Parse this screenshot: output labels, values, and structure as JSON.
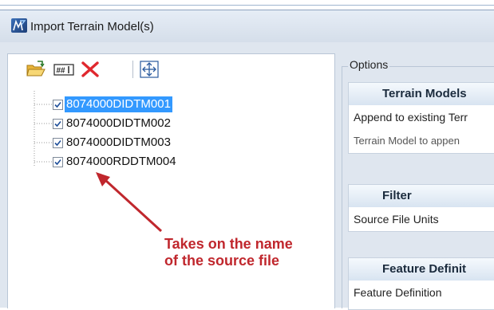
{
  "window": {
    "title": "Import Terrain Model(s)"
  },
  "toolbar": {
    "buttons": [
      {
        "icon": "folder-open-icon"
      },
      {
        "icon": "hash-grid-icon"
      },
      {
        "icon": "delete-x-icon"
      },
      {
        "icon": "move-arrows-icon"
      }
    ]
  },
  "tree": {
    "items": [
      {
        "label": "8074000DIDTM001",
        "checked": true,
        "selected": true
      },
      {
        "label": "8074000DIDTM002",
        "checked": true,
        "selected": false
      },
      {
        "label": "8074000DIDTM003",
        "checked": true,
        "selected": false
      },
      {
        "label": "8074000RDDTM004",
        "checked": true,
        "selected": false
      }
    ]
  },
  "annotation": {
    "line1": "Takes on the name",
    "line2": "of the source file",
    "color": "#c0272d"
  },
  "options": {
    "label": "Options",
    "terrain_models": {
      "header": "Terrain Models",
      "append_label": "Append to existing Terr",
      "append_target_label": "Terrain Model to appen"
    },
    "filter": {
      "header": "Filter",
      "units_label": "Source File Units"
    },
    "feature": {
      "header": "Feature Definit",
      "definition_label": "Feature Definition"
    }
  },
  "colors": {
    "selection": "#3399ff",
    "accent_icon": "#2a5a9e",
    "delete": "#e0282e"
  }
}
